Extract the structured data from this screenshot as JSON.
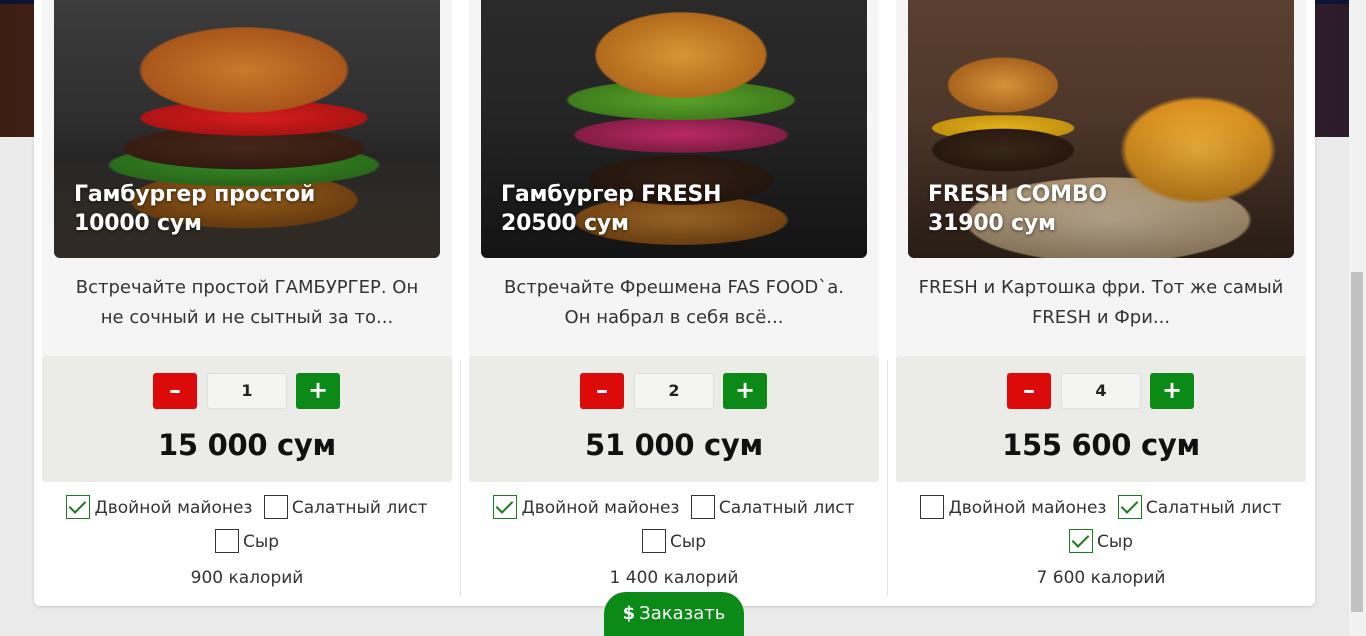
{
  "products": [
    {
      "name": "Гамбургер простой",
      "price": "10000 сум",
      "description": "Встречайте простой ГАМБУРГЕР. Он не сочный и не сытный за то...",
      "quantity": "1",
      "total": "15 000 сум",
      "options": [
        {
          "label": "Двойной майонез",
          "checked": true
        },
        {
          "label": "Салатный лист",
          "checked": false
        },
        {
          "label": "Сыр",
          "checked": false
        }
      ],
      "calories": "900 калорий"
    },
    {
      "name": "Гамбургер FRESH",
      "price": "20500 сум",
      "description": "Встречайте Фрешмена FAS FOOD`а. Он набрал в себя всё...",
      "quantity": "2",
      "total": "51 000 сум",
      "options": [
        {
          "label": "Двойной майонез",
          "checked": true
        },
        {
          "label": "Салатный лист",
          "checked": false
        },
        {
          "label": "Сыр",
          "checked": false
        }
      ],
      "calories": "1 400 калорий"
    },
    {
      "name": "FRESH COMBO",
      "price": "31900 сум",
      "description": "FRESH и Картошка фри. Тот же самый FRESH и Фри...",
      "quantity": "4",
      "total": "155 600 сум",
      "options": [
        {
          "label": "Двойной майонез",
          "checked": false
        },
        {
          "label": "Салатный лист",
          "checked": true
        },
        {
          "label": "Сыр",
          "checked": true
        }
      ],
      "calories": "7 600 калорий"
    }
  ],
  "controls": {
    "minus": "–",
    "plus": "+"
  },
  "order_button": {
    "icon": "$",
    "label": "Заказать"
  },
  "colors": {
    "minus": "#dd0a0a",
    "plus": "#0b8a17",
    "order": "#0b8a17"
  }
}
